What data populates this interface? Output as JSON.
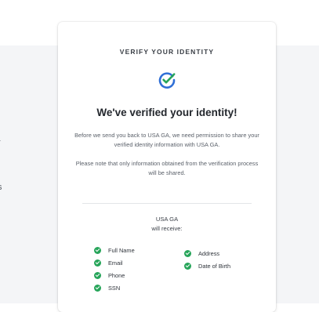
{
  "background": {
    "left_text_fragments": [
      "r",
      "s"
    ]
  },
  "card": {
    "heading": "VERIFY YOUR IDENTITY",
    "title": "We've verified your identity!",
    "paragraph_1": "Before we send you back to USA GA, we need permission to share your verified identity information with USA GA.",
    "paragraph_2": "Please note that only information obtained from the verification process will be shared.",
    "recipient_name": "USA GA",
    "recipient_suffix": "will receive:",
    "fields_left": [
      "Full Name",
      "Email",
      "Phone",
      "SSN"
    ],
    "fields_right": [
      "Address",
      "Date of Birth"
    ]
  },
  "colors": {
    "accent_blue": "#2f6fd6",
    "check_green": "#27a55a",
    "heading_text": "#3a3f46"
  },
  "icons": {
    "verified": "verified-check-icon",
    "field_check": "green-check-icon"
  }
}
